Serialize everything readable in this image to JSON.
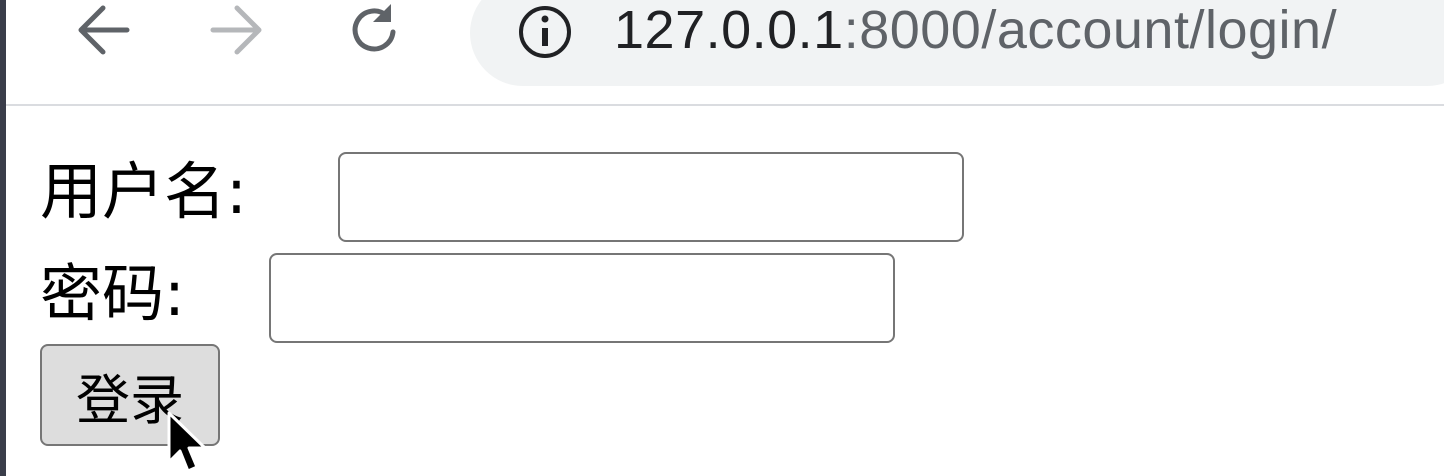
{
  "browser": {
    "url_host": "127.0.0.1",
    "url_path": ":8000/account/login/",
    "back_icon": "arrow-left-icon",
    "forward_icon": "arrow-right-icon",
    "reload_icon": "reload-icon",
    "site_info_icon": "info-icon"
  },
  "login_form": {
    "username_label": "用户名:",
    "username_value": "",
    "password_label": "密码:",
    "password_value": "",
    "submit_label": "登录"
  },
  "colors": {
    "omnibox_bg": "#f1f3f4",
    "button_bg": "#dddddd",
    "input_border": "#767676"
  }
}
